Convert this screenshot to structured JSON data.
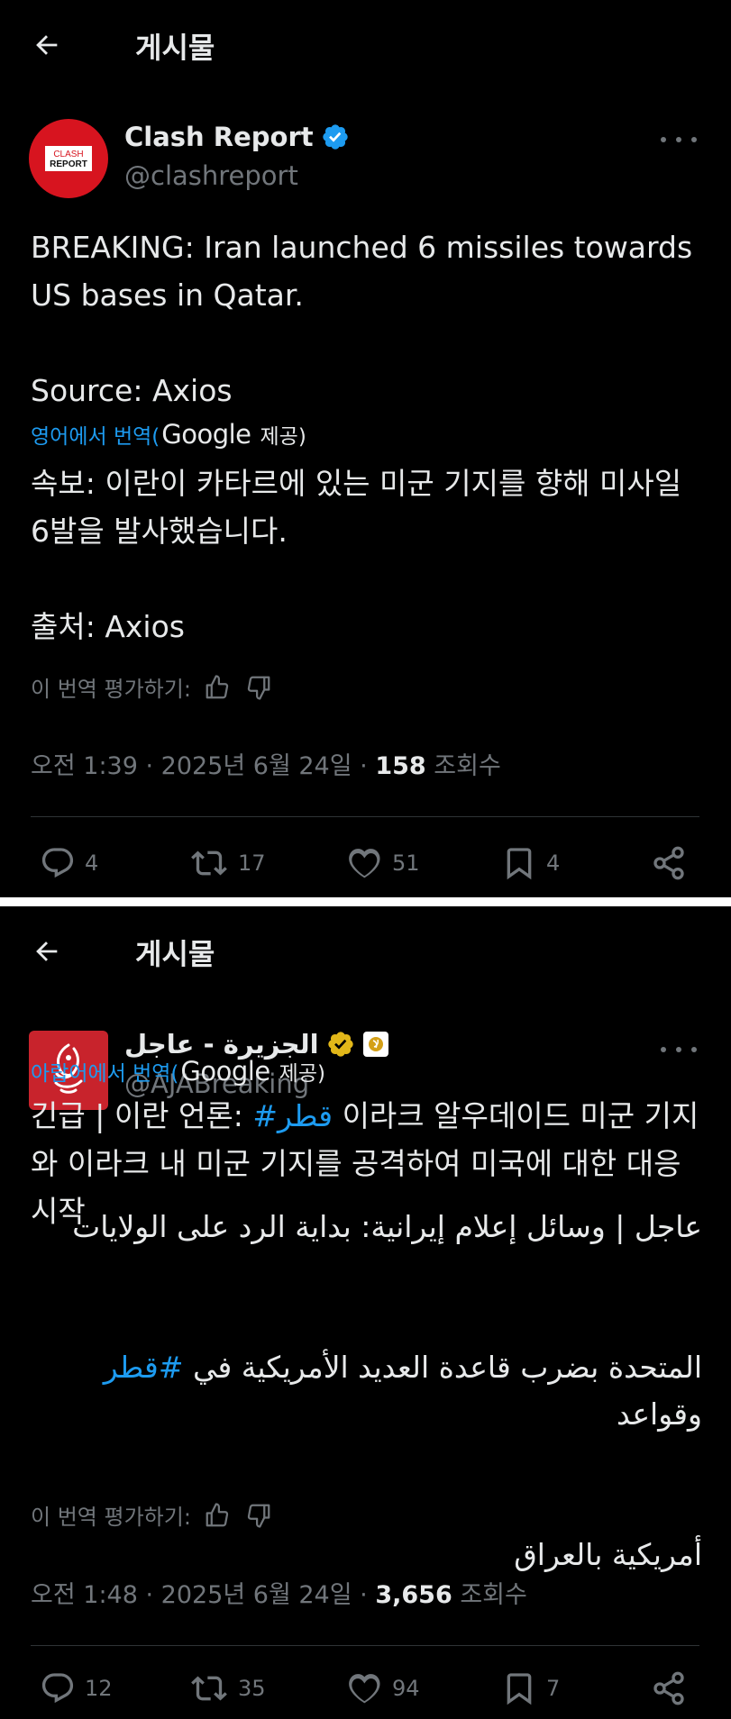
{
  "posts": [
    {
      "header_title": "게시물",
      "author": {
        "name": "Clash Report",
        "handle": "@clashreport",
        "avatar_text_1": "CLASH",
        "avatar_text_2": "REPORT"
      },
      "original_text": "BREAKING: Iran launched 6 missiles towards US bases in Qatar.\n\nSource: Axios",
      "translated_from": "영어에서 번역(",
      "google": "Google",
      "provided": "제공)",
      "translation": "속보: 이란이 카타르에 있는 미군 기지를 향해 미사일 6발을 발사했습니다.\n\n출처: Axios",
      "rate_label": "이 번역 평가하기:",
      "time": "오전 1:39 · 2025년 6월 24일 · ",
      "views": "158",
      "views_label": " 조회수",
      "stats": {
        "replies": "4",
        "reposts": "17",
        "likes": "51",
        "bookmarks": "4"
      }
    },
    {
      "header_title": "게시물",
      "author": {
        "name": "الجزيرة - عاجل",
        "handle": "@AJABreaking"
      },
      "original_line1": "عاجل | وسائل إعلام إيرانية: بداية الرد على الولايات",
      "original_line2_pre": "المتحدة بضرب قاعدة العديد الأمريكية في ",
      "original_hashtag": "#قطر",
      "original_line2_post": " وقواعد",
      "original_line3": "أمريكية بالعراق",
      "translated_from": "아랍어에서 번역(",
      "google": "Google",
      "provided": "제공)",
      "translation_pre": "긴급 | 이란 언론: ",
      "translation_hashtag": "#قطر",
      "translation_post": " 이라크 알우데이드 미군 기지\n와 이라크 내 미군 기지를 공격하여 미국에 대한 대응\n시작",
      "rate_label": "이 번역 평가하기:",
      "time": "오전 1:48 · 2025년 6월 24일 · ",
      "views": "3,656",
      "views_label": " 조회수",
      "stats": {
        "replies": "12",
        "reposts": "35",
        "likes": "94",
        "bookmarks": "7"
      }
    }
  ],
  "colors": {
    "background": "#000000",
    "text": "#e7e9ea",
    "muted": "#71767b",
    "link": "#1d9bf0",
    "verified_blue": "#1d9bf0",
    "verified_gold": "#e2b719",
    "divider": "#2f3336",
    "clash_red": "#d7141f",
    "aljazeera_red": "#c8232c"
  },
  "icons": [
    "back-arrow-icon",
    "verified-badge-icon",
    "more-icon",
    "thumbs-up-icon",
    "thumbs-down-icon",
    "reply-icon",
    "repost-icon",
    "like-icon",
    "bookmark-icon",
    "share-icon"
  ]
}
